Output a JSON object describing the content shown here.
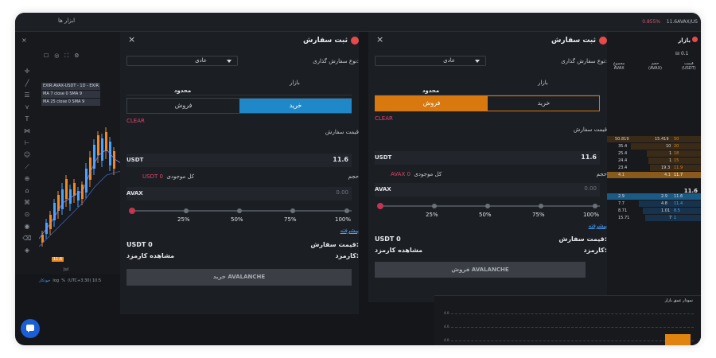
{
  "topbar": {
    "tools": "ابزار ها",
    "ticker_change": "0.855%",
    "ticker_symbol": "11.6AVAX/US"
  },
  "chart": {
    "legend": [
      "EXIR:AVAX-USDT - 1D - EXIR",
      "MA 7 close 0 SMA 9",
      "MA 25 close 0 SMA 9"
    ],
    "price_tag": "11.6",
    "date_label": "Jul",
    "footer_mode": "خودکار",
    "footer_log": "log",
    "footer_pct": "%",
    "footer_tz": "(UTC+3:30) 10:5"
  },
  "buy_dialog": {
    "title": "ثبت سفارش",
    "order_type_label": "نوع سفارش گذاری:",
    "order_type_value": "عادی",
    "tab_market": "بازار",
    "tab_limit": "محدود",
    "buy_label": "خرید",
    "sell_label": "فروش",
    "clear_label": "CLEAR",
    "price_label": "قیمت سفارش",
    "price_unit": "USDT",
    "price_value": "11.6",
    "available_label": "کل موجودی",
    "available_value": "USDT 0",
    "volume_label": "حجم",
    "volume_unit": "AVAX",
    "volume_value": "0.00",
    "pcts": [
      "25%",
      "50%",
      "75%",
      "100%"
    ],
    "advanced_label": "پیشرفته",
    "order_price_label": "قیمت سفارش:",
    "order_price_value": "USDT 0",
    "fee_label": "کارمزد:",
    "fee_view": "مشاهده کارمزد",
    "submit_label": "خرید AVALANCHE"
  },
  "sell_dialog": {
    "title": "ثبت سفارش",
    "order_type_label": "نوع سفارش گذاری:",
    "order_type_value": "عادی",
    "tab_market": "بازار",
    "tab_limit": "محدود",
    "buy_label": "خرید",
    "sell_label": "فروش",
    "clear_label": "CLEAR",
    "price_label": "قیمت سفارش",
    "price_unit": "USDT",
    "price_value": "11.6",
    "available_label": "کل موجودی",
    "available_value": "AVAX 0",
    "volume_label": "حجم",
    "volume_unit": "AVAX",
    "volume_value": "0.00",
    "pcts": [
      "25%",
      "50%",
      "75%",
      "100%"
    ],
    "advanced_label": "پیشرفته",
    "order_price_label": "قیمت سفارش:",
    "order_price_value": "USDT 0",
    "fee_label": "کارمزد:",
    "fee_view": "مشاهده کارمزد",
    "submit_label": "فروش AVALANCHE"
  },
  "orderbook": {
    "title": "بازار",
    "precision": "0.1",
    "col_total": "مجموع",
    "col_total_unit": "AVAX",
    "col_volume": "حجم",
    "col_volume_unit": "(AVAX)",
    "col_price": "قیمت",
    "col_price_unit": "(USDT)",
    "asks": [
      {
        "total": "50.819",
        "volume": "15.419",
        "price": "50"
      },
      {
        "total": "35.4",
        "volume": "10",
        "price": "20"
      },
      {
        "total": "25.4",
        "volume": "1",
        "price": "18"
      },
      {
        "total": "24.4",
        "volume": "1",
        "price": "15"
      },
      {
        "total": "23.4",
        "volume": "19.3",
        "price": "11.9"
      },
      {
        "total": "4.1",
        "volume": "4.1",
        "price": "11.7"
      }
    ],
    "mid_price": "11.6",
    "bids": [
      {
        "total": "2.9",
        "volume": "2.9",
        "price": "11.6"
      },
      {
        "total": "7.7",
        "volume": "4.8",
        "price": "11.4"
      },
      {
        "total": "8.71",
        "volume": "1.01",
        "price": "8.5"
      },
      {
        "total": "15.71",
        "volume": "7",
        "price": "1"
      }
    ],
    "depth_title": "نمودار عمق بازار",
    "depth_labels": [
      "4.0",
      "4.0",
      "4.0"
    ]
  },
  "colors": {
    "buy_accent": "#1e88c9",
    "sell_accent": "#d87910",
    "clear": "#e2476a",
    "brand": "#e64a4a"
  }
}
